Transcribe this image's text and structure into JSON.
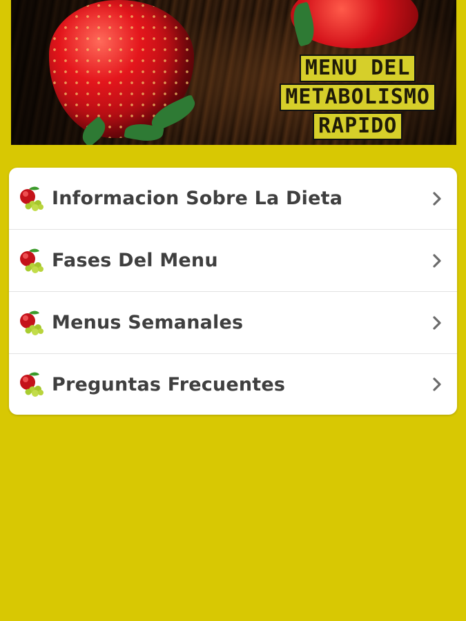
{
  "banner": {
    "title_lines": [
      "MENU DEL",
      "METABOLISMO",
      "RAPIDO"
    ],
    "image": "strawberry-banner"
  },
  "menu": {
    "items": [
      {
        "label": "Informacion Sobre La Dieta",
        "icon": "fruit-icon"
      },
      {
        "label": "Fases Del Menu",
        "icon": "fruit-icon"
      },
      {
        "label": "Menus Semanales",
        "icon": "fruit-icon"
      },
      {
        "label": "Preguntas Frecuentes",
        "icon": "fruit-icon"
      }
    ]
  },
  "colors": {
    "background": "#d8c803",
    "card": "#ffffff",
    "text": "#3f3f3f",
    "chevron": "#6b6b6b",
    "title_bg": "#d6cf2a"
  }
}
